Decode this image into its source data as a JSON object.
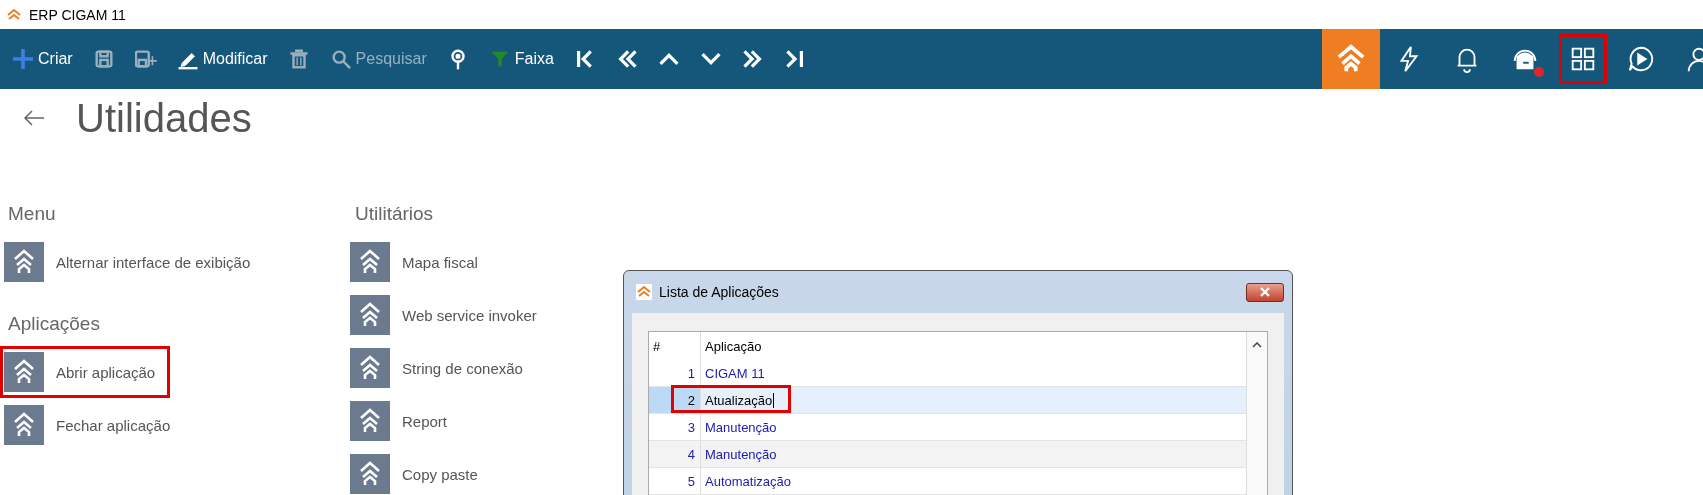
{
  "window": {
    "title": "ERP CIGAM 11"
  },
  "toolbar": {
    "left": [
      {
        "kind": "create",
        "label": "Criar",
        "disabled": false
      },
      {
        "kind": "save",
        "disabled": true
      },
      {
        "kind": "save-new",
        "disabled": true
      },
      {
        "kind": "edit",
        "label": "Modificar",
        "disabled": false
      },
      {
        "kind": "delete",
        "disabled": true
      },
      {
        "kind": "search",
        "label": "Pesquisar",
        "disabled": true
      },
      {
        "kind": "pin",
        "disabled": false
      },
      {
        "kind": "filter",
        "label": "Faixa",
        "disabled": false
      },
      {
        "kind": "first",
        "disabled": false
      },
      {
        "kind": "prev-page",
        "disabled": false
      },
      {
        "kind": "prev",
        "disabled": false
      },
      {
        "kind": "next",
        "disabled": false
      },
      {
        "kind": "next-page",
        "disabled": false
      },
      {
        "kind": "last",
        "disabled": false
      }
    ],
    "right": [
      {
        "kind": "logo",
        "highlighted": false,
        "alert": false
      },
      {
        "kind": "lightning",
        "highlighted": false,
        "alert": false
      },
      {
        "kind": "bell",
        "highlighted": false,
        "alert": false
      },
      {
        "kind": "support",
        "highlighted": false,
        "alert": true
      },
      {
        "kind": "apps",
        "highlighted": true,
        "alert": false
      },
      {
        "kind": "play",
        "highlighted": false,
        "alert": false
      },
      {
        "kind": "user",
        "highlighted": false
      }
    ]
  },
  "page": {
    "title": "Utilidades",
    "columns": [
      {
        "sections": [
          {
            "title": "Menu",
            "items": [
              {
                "label": "Alternar interface de exibição",
                "highlighted": false
              }
            ]
          },
          {
            "title": "Aplicações",
            "items": [
              {
                "label": "Abrir aplicação",
                "highlighted": true
              },
              {
                "label": "Fechar aplicação",
                "highlighted": false
              }
            ]
          }
        ]
      },
      {
        "sections": [
          {
            "title": "Utilitários",
            "items": [
              {
                "label": "Mapa fiscal",
                "highlighted": false
              },
              {
                "label": "Web service invoker",
                "highlighted": false
              },
              {
                "label": "String de conexão",
                "highlighted": false
              },
              {
                "label": "Report",
                "highlighted": false
              },
              {
                "label": "Copy paste",
                "highlighted": false
              }
            ]
          }
        ]
      }
    ]
  },
  "dialog": {
    "title": "Lista de Aplicações",
    "columns": [
      "#",
      "Aplicação"
    ],
    "rows": [
      {
        "number": "1",
        "name": "CIGAM 11",
        "selected": false,
        "highlighted": false,
        "editing": false
      },
      {
        "number": "2",
        "name": "Atualização",
        "selected": true,
        "highlighted": true,
        "editing": true
      },
      {
        "number": "3",
        "name": "Manutenção",
        "selected": false,
        "highlighted": false,
        "editing": false
      },
      {
        "number": "4",
        "name": "Manutenção",
        "selected": false,
        "highlighted": false,
        "editing": false
      },
      {
        "number": "5",
        "name": "Automatização",
        "selected": false,
        "highlighted": false,
        "editing": false
      }
    ]
  }
}
